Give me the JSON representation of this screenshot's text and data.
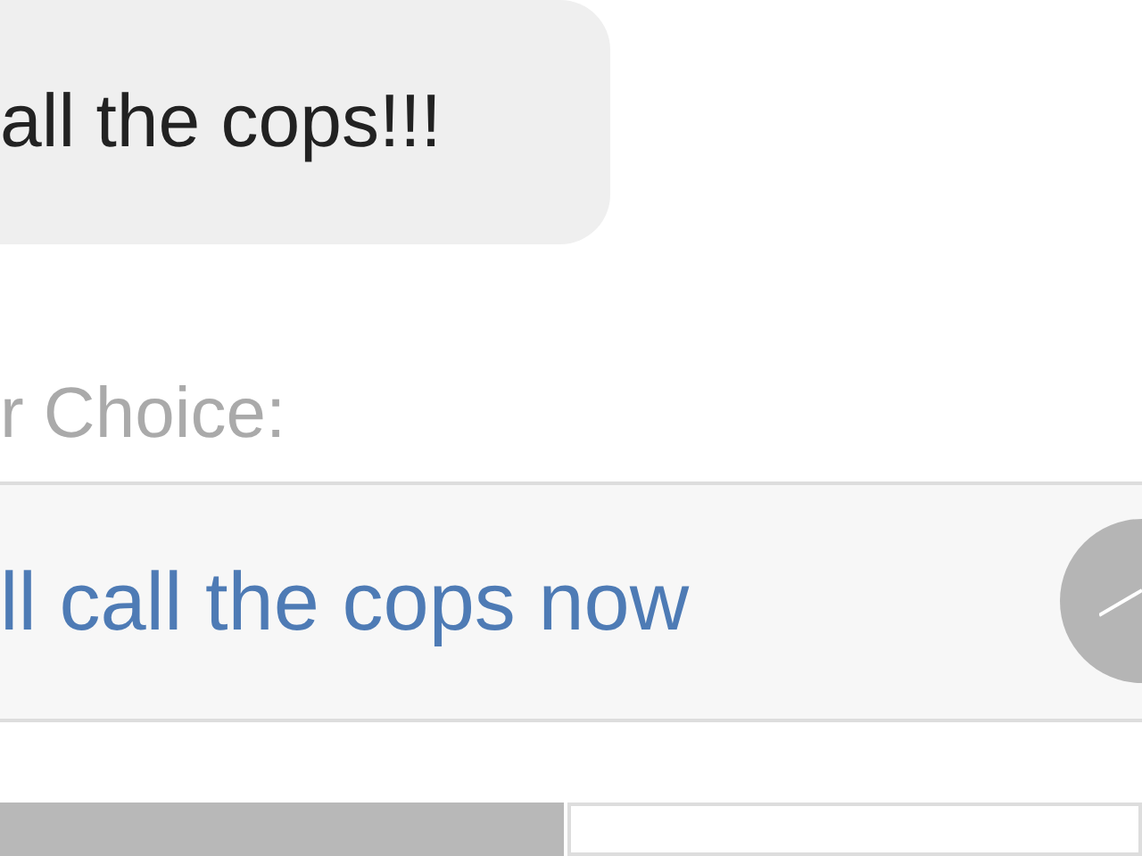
{
  "message": {
    "text": "all the cops!!!"
  },
  "prompt": "r Choice:",
  "choices": [
    {
      "text": "ll call the cops now",
      "selected": false
    }
  ]
}
